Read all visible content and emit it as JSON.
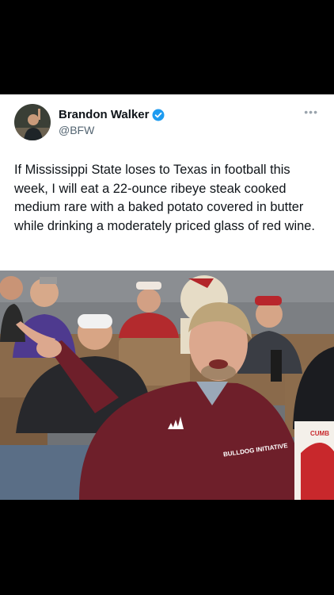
{
  "post": {
    "display_name": "Brandon Walker",
    "handle": "@BFW",
    "text": "If Mississippi State loses to Texas in football this week, I will eat a 22-ounce ribeye steak cooked medium rare with a baked potato covered in butter while drinking a moderately priced glass of red wine.",
    "verified": true,
    "more_icon": "more-options-icon"
  },
  "photo": {
    "jacket_logo_text": "BULLDOG INITIATIVE",
    "brand_mark": "adidas"
  },
  "colors": {
    "background": "#000000",
    "card": "#ffffff",
    "text": "#0f1419",
    "handle": "#536471",
    "verified": "#1d9bf0",
    "jacket": "#6e1f2a"
  }
}
